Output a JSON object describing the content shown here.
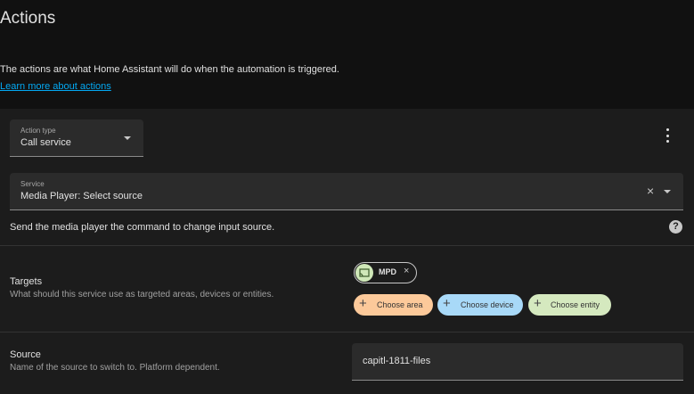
{
  "section": {
    "title": "Actions",
    "description": "The actions are what Home Assistant will do when the automation is triggered.",
    "learn_more": "Learn more about actions"
  },
  "action": {
    "type_label": "Action type",
    "type_value": "Call service",
    "service_label": "Service",
    "service_value": "Media Player: Select source",
    "service_description": "Send the media player the command to change input source.",
    "help_icon": "?",
    "clear_icon": "×",
    "more_icon": "more-vertical-icon"
  },
  "targets": {
    "label": "Targets",
    "description": "What should this service use as targeted areas, devices or entities.",
    "selected": [
      {
        "name": "MPD",
        "icon": "cast-icon",
        "remove": "×"
      }
    ],
    "add_buttons": {
      "area": "Choose area",
      "device": "Choose device",
      "entity": "Choose entity",
      "plus": "+"
    }
  },
  "source": {
    "label": "Source",
    "description": "Name of the source to switch to. Platform dependent.",
    "value": "capitl-1811-files"
  },
  "colors": {
    "background": "#111111",
    "card": "#1c1c1c",
    "field": "#2b2b2b",
    "link": "#03a9f4",
    "area_chip": "#fcc99a",
    "device_chip": "#a8d9f8",
    "entity_chip": "#d5e9bf"
  }
}
